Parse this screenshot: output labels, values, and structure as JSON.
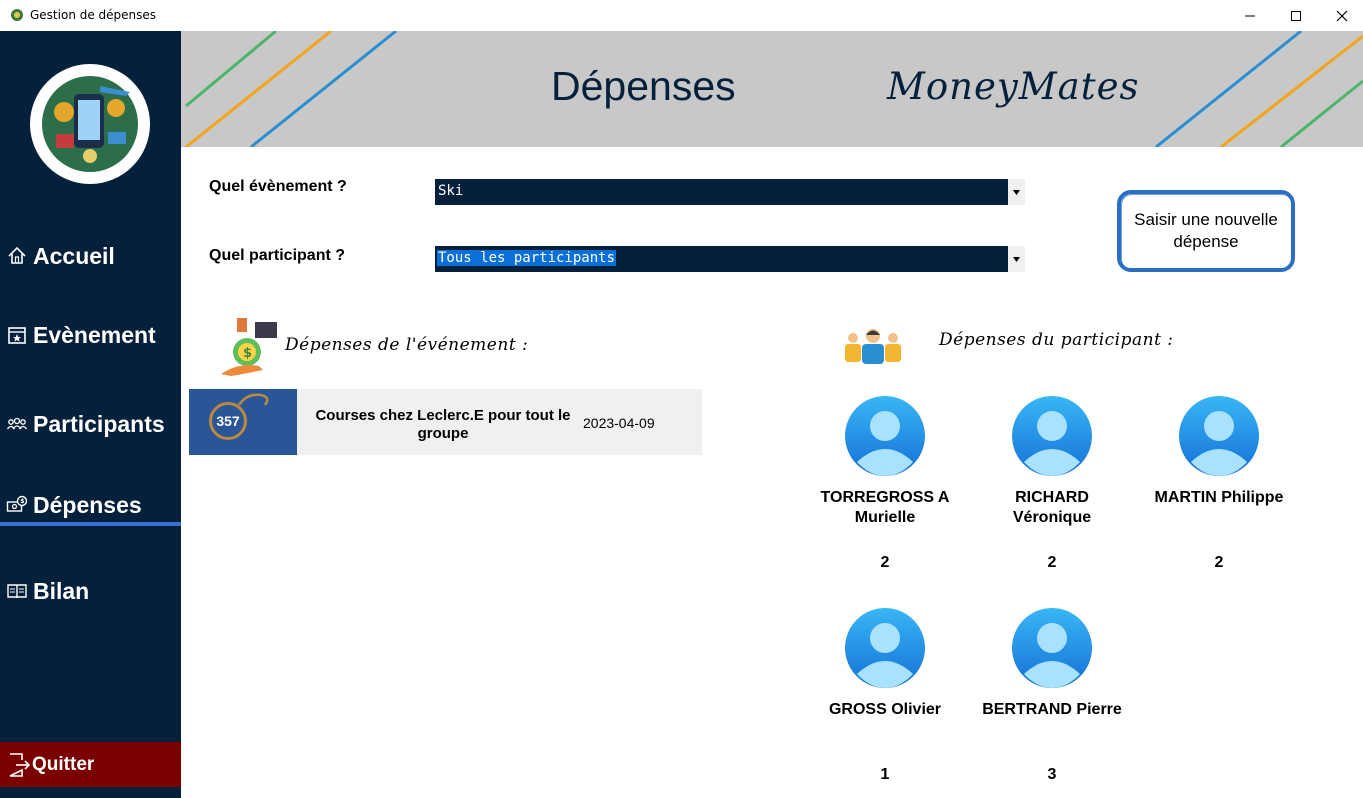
{
  "window": {
    "title": "Gestion de dépenses"
  },
  "sidebar": {
    "items": [
      {
        "label": "Accueil",
        "icon": "home-icon"
      },
      {
        "label": "Evènement",
        "icon": "calendar-star-icon"
      },
      {
        "label": "Participants",
        "icon": "group-icon"
      },
      {
        "label": "Dépenses",
        "icon": "money-icon",
        "active": true
      },
      {
        "label": "Bilan",
        "icon": "book-icon"
      }
    ],
    "quit_label": "Quitter"
  },
  "header": {
    "title": "Dépenses",
    "brand": "MoneyMates"
  },
  "form": {
    "event_label": "Quel évènement ?",
    "event_value": "Ski",
    "participant_label": "Quel participant ?",
    "participant_value": "Tous les participants",
    "new_expense_button": "Saisir une nouvelle dépense"
  },
  "event_section": {
    "title": "Dépenses de l'événement :",
    "expenses": [
      {
        "amount": "357",
        "description": "Courses chez Leclerc.E pour tout le groupe",
        "date": "2023-04-09"
      }
    ]
  },
  "participant_section": {
    "title": "Dépenses du participant :",
    "participants": [
      {
        "name": "TORREGROSS A Murielle",
        "count": "2"
      },
      {
        "name": "RICHARD Véronique",
        "count": "2"
      },
      {
        "name": "MARTIN Philippe",
        "count": "2"
      },
      {
        "name": "GROSS Olivier",
        "count": "1"
      },
      {
        "name": "BERTRAND Pierre",
        "count": "3"
      }
    ]
  },
  "colors": {
    "sidebar_bg": "#05203a",
    "quit_bg": "#7a0000",
    "active_underline": "#3b6fd6",
    "banner_bg": "#c8c8c8",
    "amount_box": "#2a5599",
    "button_border": "#2b6fc4"
  }
}
